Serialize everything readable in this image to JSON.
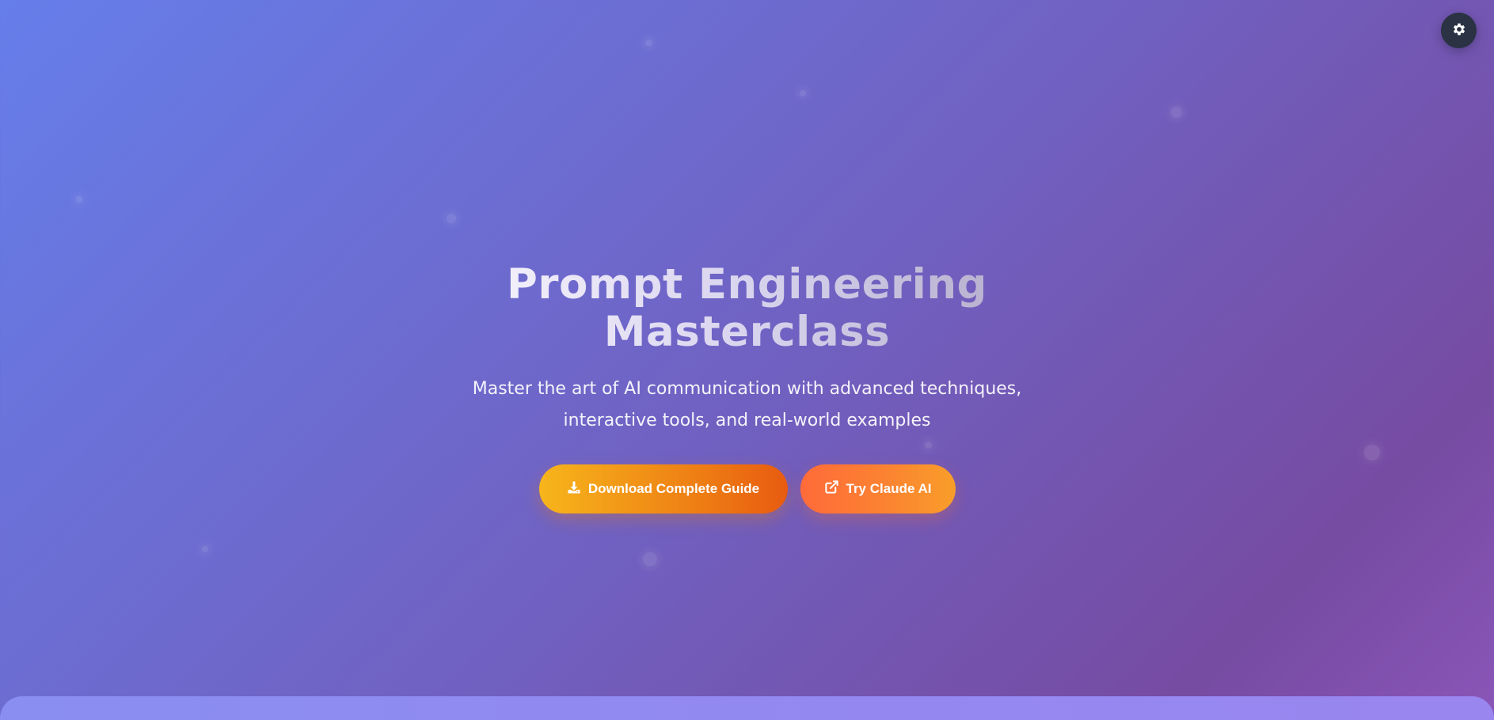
{
  "theme_toggle": {
    "icon": "gear-icon"
  },
  "hero": {
    "title": "Prompt Engineering Masterclass",
    "subtitle": "Master the art of AI communication with advanced techniques, interactive tools, and real-world examples"
  },
  "actions": {
    "primary": {
      "label": "Download Complete Guide",
      "icon": "download-icon"
    },
    "secondary": {
      "label": "Try Claude AI",
      "icon": "external-link-icon"
    }
  },
  "colors": {
    "background_start": "#667eea",
    "background_end": "#764ba2",
    "primary_button_start": "#f7b51b",
    "primary_button_end": "#e85b10",
    "secondary_button_start": "#ff6b3a",
    "secondary_button_end": "#f99e2a",
    "toggle_background": "#2a3243"
  }
}
